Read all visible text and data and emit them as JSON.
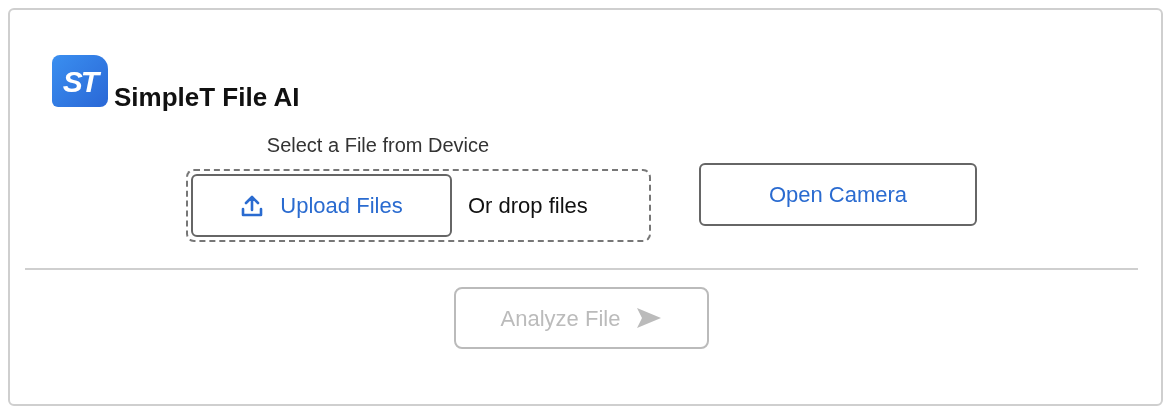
{
  "app": {
    "logo_text": "ST",
    "title": "SimpleT File AI"
  },
  "upload": {
    "label": "Select a File from Device",
    "upload_button": "Upload Files",
    "drop_hint": "Or drop files"
  },
  "camera_button": {
    "label": "Open Camera"
  },
  "analyze_button": {
    "label": "Analyze File",
    "disabled": true
  }
}
